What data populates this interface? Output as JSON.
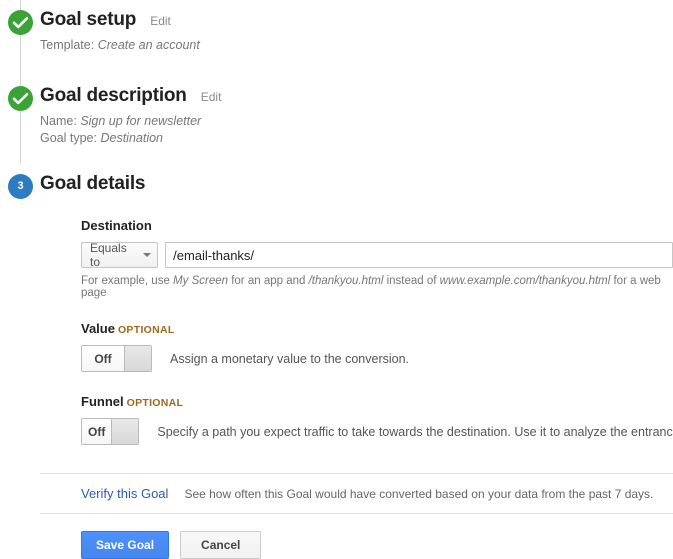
{
  "steps": [
    {
      "id": "goal-setup",
      "marker": "check-icon",
      "state": "done",
      "title": "Goal setup",
      "edit_label": "Edit",
      "summary": [
        {
          "label": "Template:",
          "value": "Create an account"
        }
      ]
    },
    {
      "id": "goal-description",
      "marker": "check-icon",
      "state": "done",
      "title": "Goal description",
      "edit_label": "Edit",
      "summary": [
        {
          "label": "Name:",
          "value": "Sign up for newsletter"
        },
        {
          "label": "Goal type:",
          "value": "Destination"
        }
      ]
    },
    {
      "id": "goal-details",
      "marker": "3",
      "state": "active",
      "title": "Goal details"
    }
  ],
  "destination": {
    "label": "Destination",
    "match_type": {
      "selected": "Equals to",
      "caret_icon": "caret-down-icon"
    },
    "input_value": "/email-thanks/",
    "input_placeholder": "",
    "hint_prefix": "For example, use ",
    "hint_em1": "My Screen",
    "hint_mid1": " for an app and ",
    "hint_em2": "/thankyou.html",
    "hint_mid2": " instead of ",
    "hint_em3": "www.example.com/thankyou.html",
    "hint_suffix": " for a web page"
  },
  "value_section": {
    "label": "Value",
    "optional_tag": "OPTIONAL",
    "toggle_state": "Off",
    "description": "Assign a monetary value to the conversion."
  },
  "funnel_section": {
    "label": "Funnel",
    "optional_tag": "OPTIONAL",
    "toggle_state": "Off",
    "description": "Specify a path you expect traffic to take towards the destination. Use it to analyze the entrance and exit points that"
  },
  "verify": {
    "link_label": "Verify this Goal",
    "description": "See how often this Goal would have converted based on your data from the past 7 days."
  },
  "actions": {
    "save_label": "Save Goal",
    "cancel_label": "Cancel"
  },
  "colors": {
    "step_done": "#39a336",
    "step_active": "#2b7cc0",
    "primary_button": "#4d90fe",
    "link": "#2a5db0",
    "optional_tag": "#9a6a1d"
  }
}
